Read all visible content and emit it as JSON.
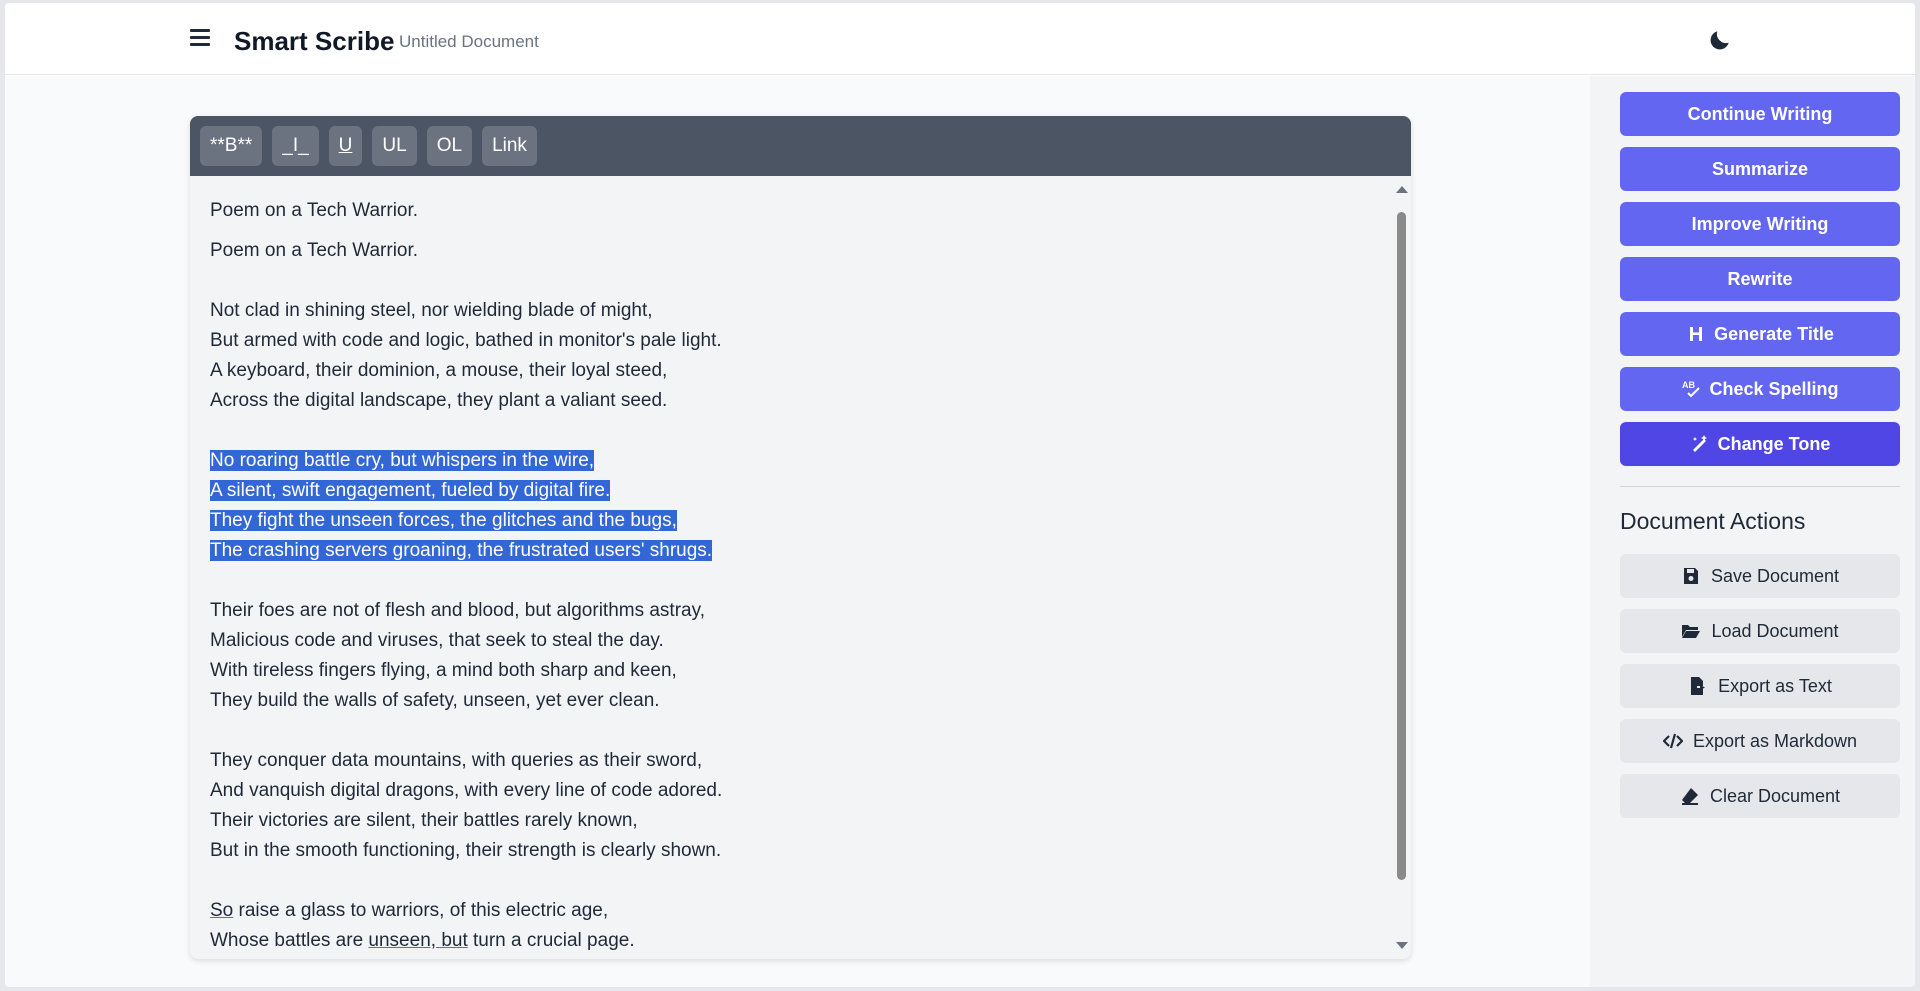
{
  "header": {
    "app_title": "Smart Scribe",
    "doc_title": "Untitled Document",
    "menu_icon": "hamburger-icon",
    "theme_icon": "moon-icon"
  },
  "toolbar": {
    "bold": "**B**",
    "italic": "_I_",
    "underline": "U",
    "ul": "UL",
    "ol": "OL",
    "link": "Link"
  },
  "editor": {
    "line_1": "Poem on a Tech Warrior.",
    "line_2": "Poem on a Tech Warrior.",
    "stanza_1": [
      "Not clad in shining steel, nor wielding blade of might,",
      "But armed with code and logic, bathed in monitor's pale light.",
      "A keyboard, their dominion, a mouse, their loyal steed,",
      "Across the digital landscape, they plant a valiant seed."
    ],
    "stanza_2": [
      "No roaring battle cry, but whispers in the wire,",
      "A silent, swift engagement, fueled by digital fire.",
      "They fight the unseen forces, the glitches and the bugs,",
      "The crashing servers groaning, the frustrated users' shrugs."
    ],
    "stanza_3": [
      "Their foes are not of flesh and blood, but algorithms astray,",
      "Malicious code and viruses, that seek to steal the day.",
      "With tireless fingers flying, a mind both sharp and keen,",
      "They build the walls of safety, unseen, yet ever clean."
    ],
    "stanza_4": [
      "They conquer data mountains, with queries as their sword,",
      "And vanquish digital dragons, with every line of code adored.",
      "Their victories are silent, their battles rarely known,",
      "But in the smooth functioning, their strength is clearly shown."
    ],
    "stanza_5": {
      "l1_a": "So",
      "l1_b": " raise a glass to warriors, of this electric age,",
      "l2_a": "Whose battles are ",
      "l2_b": "unseen, but",
      "l2_c": " turn a crucial page."
    }
  },
  "ai_actions": [
    {
      "label": "Continue Writing"
    },
    {
      "label": "Summarize"
    },
    {
      "label": "Improve Writing"
    },
    {
      "label": "Rewrite"
    },
    {
      "label": "Generate Title",
      "icon": "heading-icon"
    },
    {
      "label": "Check Spelling",
      "icon": "spell-check-icon"
    },
    {
      "label": "Change Tone",
      "icon": "magic-wand-icon"
    }
  ],
  "document_actions": {
    "title": "Document Actions",
    "items": [
      {
        "label": "Save Document",
        "icon": "save-icon"
      },
      {
        "label": "Load Document",
        "icon": "folder-open-icon"
      },
      {
        "label": "Export as Text",
        "icon": "file-export-icon"
      },
      {
        "label": "Export as Markdown",
        "icon": "code-icon"
      },
      {
        "label": "Clear Document",
        "icon": "eraser-icon"
      }
    ]
  },
  "colors": {
    "accent": "#6366f1",
    "accent_active": "#4f46e5",
    "selection": "#3367d6",
    "toolbar": "#4b5563"
  }
}
